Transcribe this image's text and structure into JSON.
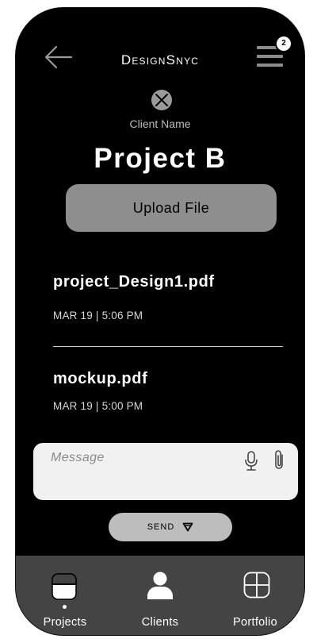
{
  "header": {
    "brand": "DesignSnyc",
    "notification_count": "2",
    "back_icon": "arrow-left-icon",
    "menu_icon": "hamburger-menu-icon"
  },
  "project": {
    "client_label": "Client Name",
    "title": "Project B",
    "client_icon": "close-circle-icon"
  },
  "upload_button": {
    "label": "Upload File"
  },
  "files": [
    {
      "name": "project_Design1.pdf",
      "date": "MAR 19 | 5:06 PM"
    },
    {
      "name": "mockup.pdf",
      "date": "MAR 19 |  5:00 PM"
    }
  ],
  "message": {
    "placeholder": "Message",
    "value": "",
    "mic_icon": "microphone-icon",
    "attach_icon": "paperclip-icon"
  },
  "send_button": {
    "label": "SEND",
    "icon": "send-triangle-icon"
  },
  "tabs": [
    {
      "label": "Projects",
      "icon": "projects-icon",
      "active": true
    },
    {
      "label": "Clients",
      "icon": "user-icon",
      "active": false
    },
    {
      "label": "Portfolio",
      "icon": "grid-icon",
      "active": false
    }
  ],
  "colors": {
    "background": "#000000",
    "upload_button": "#8e8e8e",
    "message_box": "#f1f1f1",
    "send_button": "#bdbdbd",
    "tab_bar": "#444444",
    "text": "#ffffff"
  }
}
